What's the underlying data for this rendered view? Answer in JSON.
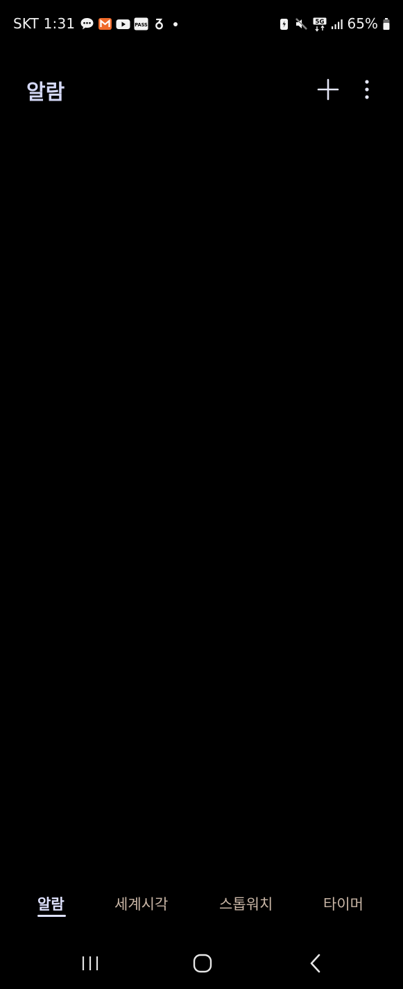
{
  "status_bar": {
    "carrier_time": "SKT 1:31",
    "notification_icons": [
      "chat-bubble-icon",
      "mail-app-icon",
      "youtube-icon",
      "pass-app-icon",
      "app-notification-icon",
      "more-dot-icon"
    ],
    "pass_label": "PASS",
    "network_label": "5G",
    "battery_text": "65%"
  },
  "header": {
    "title": "알람"
  },
  "tabs": [
    {
      "label": "알람",
      "active": true
    },
    {
      "label": "세계시각",
      "active": false
    },
    {
      "label": "스톱워치",
      "active": false
    },
    {
      "label": "타이머",
      "active": false
    }
  ],
  "colors": {
    "background": "#000000",
    "title": "#d4d8f6",
    "active_tab": "#dfe2ff",
    "inactive_tab": "#c9b6a6"
  }
}
